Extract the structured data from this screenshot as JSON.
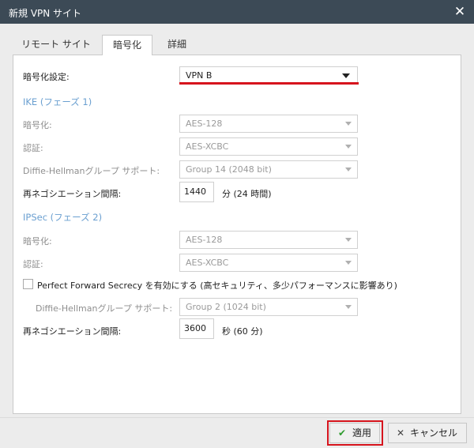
{
  "window": {
    "title": "新規 VPN サイト",
    "close_glyph": "✕"
  },
  "tabs": [
    {
      "label": "リモート サイト"
    },
    {
      "label": "暗号化"
    },
    {
      "label": "詳細"
    }
  ],
  "encryption_setting": {
    "label": "暗号化設定:",
    "value": "VPN B"
  },
  "ike": {
    "heading": "IKE (フェーズ 1)",
    "encryption": {
      "label": "暗号化:",
      "value": "AES-128"
    },
    "auth": {
      "label": "認証:",
      "value": "AES-XCBC"
    },
    "dh_group": {
      "label": "Diffie-Hellmanグループ サポート:",
      "value": "Group 14 (2048 bit)"
    },
    "renegotiation": {
      "label": "再ネゴシエーション間隔:",
      "value": "1440",
      "unit": "分 (24 時間)"
    }
  },
  "ipsec": {
    "heading": "IPSec (フェーズ 2)",
    "encryption": {
      "label": "暗号化:",
      "value": "AES-128"
    },
    "auth": {
      "label": "認証:",
      "value": "AES-XCBC"
    },
    "pfs": {
      "label": "Perfect Forward Secrecy を有効にする (高セキュリティ、多少パフォーマンスに影響あり)",
      "checked": false
    },
    "dh_group": {
      "label": "Diffie-Hellmanグループ サポート:",
      "value": "Group 2 (1024 bit)"
    },
    "renegotiation": {
      "label": "再ネゴシエーション間隔:",
      "value": "3600",
      "unit": "秒 (60 分)"
    }
  },
  "footer": {
    "apply": {
      "label": "適用",
      "icon": "check-icon",
      "glyph": "✔"
    },
    "cancel": {
      "label": "キャンセル",
      "icon": "x-icon",
      "glyph": "✕"
    }
  },
  "colors": {
    "titlebar": "#3c4a56",
    "accent_red": "#d6141d",
    "section_blue": "#6a9fd0",
    "apply_check": "#2d9b2d"
  }
}
